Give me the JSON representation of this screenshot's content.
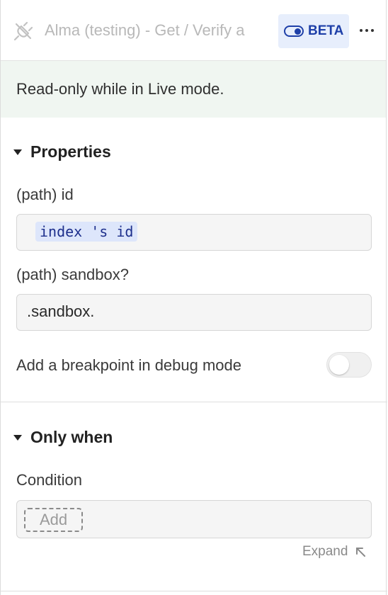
{
  "header": {
    "title": "Alma (testing) - Get / Verify a",
    "badge": "BETA",
    "plug_icon": "plug-disconnected-icon",
    "more_icon": "more-horizontal-icon"
  },
  "notice": {
    "text": "Read-only while in Live mode."
  },
  "properties": {
    "title": "Properties",
    "path_id_label": "(path) id",
    "path_id_value": "index 's id",
    "sandbox_label": "(path) sandbox?",
    "sandbox_value": ".sandbox.",
    "breakpoint_label": "Add a breakpoint in debug mode",
    "breakpoint_enabled": false
  },
  "only_when": {
    "title": "Only when",
    "condition_label": "Condition",
    "add_label": "Add",
    "expand_label": "Expand"
  },
  "colors": {
    "accent": "#1e3fa8",
    "notice_bg": "#f0f6f1",
    "badge_bg": "#e7eefc"
  }
}
